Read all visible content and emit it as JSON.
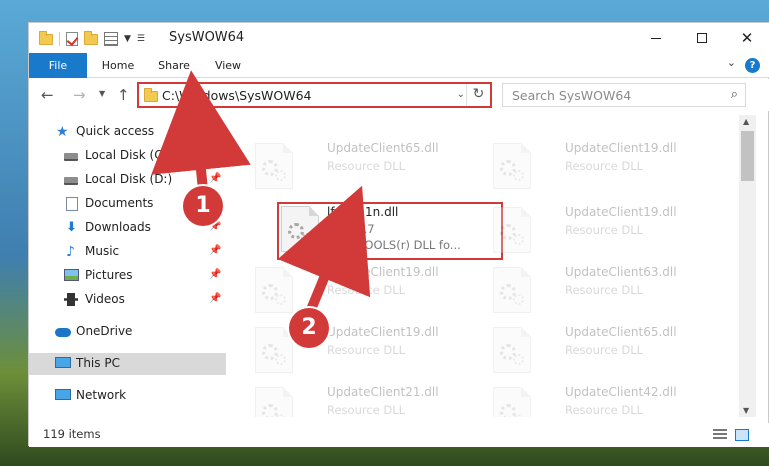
{
  "window": {
    "title": "SysWOW64",
    "controls": {
      "minimize": "",
      "maximize": "",
      "close": "✕"
    }
  },
  "ribbon": {
    "tabs": [
      "File",
      "Home",
      "Share",
      "View"
    ],
    "help": "?"
  },
  "nav": {
    "back": "←",
    "forward": "→",
    "up": "↑",
    "address": "C:\\Windows\\SysWOW64",
    "search_placeholder": "Search SysWOW64"
  },
  "sidebar": {
    "items": [
      {
        "label": "Quick access",
        "pinned": false
      },
      {
        "label": "Local Disk (C:)",
        "pinned": true
      },
      {
        "label": "Local Disk (D:)",
        "pinned": true
      },
      {
        "label": "Documents",
        "pinned": true
      },
      {
        "label": "Downloads",
        "pinned": true
      },
      {
        "label": "Music",
        "pinned": true
      },
      {
        "label": "Pictures",
        "pinned": true
      },
      {
        "label": "Videos",
        "pinned": true
      },
      {
        "label": "OneDrive",
        "pinned": false
      },
      {
        "label": "This PC",
        "pinned": false,
        "selected": true
      },
      {
        "label": "Network",
        "pinned": false
      }
    ]
  },
  "files": {
    "highlighted": {
      "name": "lfpng11n.dll",
      "version": "11.5.0.7",
      "description": "LEADTOOLS(r) DLL fo..."
    },
    "faded": [
      {
        "name": "UpdateClient65.dll",
        "type": "Resource DLL"
      },
      {
        "name": "UpdateClient19.dll",
        "type": "Resource DLL"
      },
      {
        "name": "UpdateClient19.dll",
        "type": "Resource DLL"
      },
      {
        "name": "UpdateClient19.dll",
        "type": "Resource DLL"
      },
      {
        "name": "UpdateClient63.dll",
        "type": "Resource DLL"
      },
      {
        "name": "UpdateClient19.dll",
        "type": "Resource DLL"
      },
      {
        "name": "UpdateClient65.dll",
        "type": "Resource DLL"
      },
      {
        "name": "UpdateClient21.dll",
        "type": "Resource DLL"
      },
      {
        "name": "UpdateClient42.dll",
        "type": "Resource DLL"
      }
    ]
  },
  "status": {
    "items": "119 items"
  },
  "annotations": {
    "step1": "1",
    "step2": "2",
    "color": "#d23a3a"
  }
}
